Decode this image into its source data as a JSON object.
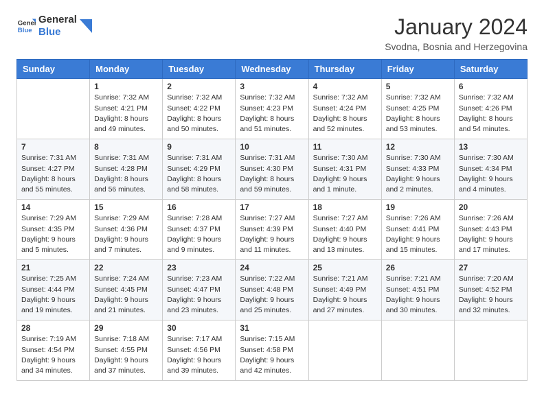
{
  "logo": {
    "text_general": "General",
    "text_blue": "Blue"
  },
  "header": {
    "month": "January 2024",
    "location": "Svodna, Bosnia and Herzegovina"
  },
  "weekdays": [
    "Sunday",
    "Monday",
    "Tuesday",
    "Wednesday",
    "Thursday",
    "Friday",
    "Saturday"
  ],
  "weeks": [
    [
      {
        "day": "",
        "sunrise": "",
        "sunset": "",
        "daylight": ""
      },
      {
        "day": "1",
        "sunrise": "Sunrise: 7:32 AM",
        "sunset": "Sunset: 4:21 PM",
        "daylight": "Daylight: 8 hours and 49 minutes."
      },
      {
        "day": "2",
        "sunrise": "Sunrise: 7:32 AM",
        "sunset": "Sunset: 4:22 PM",
        "daylight": "Daylight: 8 hours and 50 minutes."
      },
      {
        "day": "3",
        "sunrise": "Sunrise: 7:32 AM",
        "sunset": "Sunset: 4:23 PM",
        "daylight": "Daylight: 8 hours and 51 minutes."
      },
      {
        "day": "4",
        "sunrise": "Sunrise: 7:32 AM",
        "sunset": "Sunset: 4:24 PM",
        "daylight": "Daylight: 8 hours and 52 minutes."
      },
      {
        "day": "5",
        "sunrise": "Sunrise: 7:32 AM",
        "sunset": "Sunset: 4:25 PM",
        "daylight": "Daylight: 8 hours and 53 minutes."
      },
      {
        "day": "6",
        "sunrise": "Sunrise: 7:32 AM",
        "sunset": "Sunset: 4:26 PM",
        "daylight": "Daylight: 8 hours and 54 minutes."
      }
    ],
    [
      {
        "day": "7",
        "sunrise": "Sunrise: 7:31 AM",
        "sunset": "Sunset: 4:27 PM",
        "daylight": "Daylight: 8 hours and 55 minutes."
      },
      {
        "day": "8",
        "sunrise": "Sunrise: 7:31 AM",
        "sunset": "Sunset: 4:28 PM",
        "daylight": "Daylight: 8 hours and 56 minutes."
      },
      {
        "day": "9",
        "sunrise": "Sunrise: 7:31 AM",
        "sunset": "Sunset: 4:29 PM",
        "daylight": "Daylight: 8 hours and 58 minutes."
      },
      {
        "day": "10",
        "sunrise": "Sunrise: 7:31 AM",
        "sunset": "Sunset: 4:30 PM",
        "daylight": "Daylight: 8 hours and 59 minutes."
      },
      {
        "day": "11",
        "sunrise": "Sunrise: 7:30 AM",
        "sunset": "Sunset: 4:31 PM",
        "daylight": "Daylight: 9 hours and 1 minute."
      },
      {
        "day": "12",
        "sunrise": "Sunrise: 7:30 AM",
        "sunset": "Sunset: 4:33 PM",
        "daylight": "Daylight: 9 hours and 2 minutes."
      },
      {
        "day": "13",
        "sunrise": "Sunrise: 7:30 AM",
        "sunset": "Sunset: 4:34 PM",
        "daylight": "Daylight: 9 hours and 4 minutes."
      }
    ],
    [
      {
        "day": "14",
        "sunrise": "Sunrise: 7:29 AM",
        "sunset": "Sunset: 4:35 PM",
        "daylight": "Daylight: 9 hours and 5 minutes."
      },
      {
        "day": "15",
        "sunrise": "Sunrise: 7:29 AM",
        "sunset": "Sunset: 4:36 PM",
        "daylight": "Daylight: 9 hours and 7 minutes."
      },
      {
        "day": "16",
        "sunrise": "Sunrise: 7:28 AM",
        "sunset": "Sunset: 4:37 PM",
        "daylight": "Daylight: 9 hours and 9 minutes."
      },
      {
        "day": "17",
        "sunrise": "Sunrise: 7:27 AM",
        "sunset": "Sunset: 4:39 PM",
        "daylight": "Daylight: 9 hours and 11 minutes."
      },
      {
        "day": "18",
        "sunrise": "Sunrise: 7:27 AM",
        "sunset": "Sunset: 4:40 PM",
        "daylight": "Daylight: 9 hours and 13 minutes."
      },
      {
        "day": "19",
        "sunrise": "Sunrise: 7:26 AM",
        "sunset": "Sunset: 4:41 PM",
        "daylight": "Daylight: 9 hours and 15 minutes."
      },
      {
        "day": "20",
        "sunrise": "Sunrise: 7:26 AM",
        "sunset": "Sunset: 4:43 PM",
        "daylight": "Daylight: 9 hours and 17 minutes."
      }
    ],
    [
      {
        "day": "21",
        "sunrise": "Sunrise: 7:25 AM",
        "sunset": "Sunset: 4:44 PM",
        "daylight": "Daylight: 9 hours and 19 minutes."
      },
      {
        "day": "22",
        "sunrise": "Sunrise: 7:24 AM",
        "sunset": "Sunset: 4:45 PM",
        "daylight": "Daylight: 9 hours and 21 minutes."
      },
      {
        "day": "23",
        "sunrise": "Sunrise: 7:23 AM",
        "sunset": "Sunset: 4:47 PM",
        "daylight": "Daylight: 9 hours and 23 minutes."
      },
      {
        "day": "24",
        "sunrise": "Sunrise: 7:22 AM",
        "sunset": "Sunset: 4:48 PM",
        "daylight": "Daylight: 9 hours and 25 minutes."
      },
      {
        "day": "25",
        "sunrise": "Sunrise: 7:21 AM",
        "sunset": "Sunset: 4:49 PM",
        "daylight": "Daylight: 9 hours and 27 minutes."
      },
      {
        "day": "26",
        "sunrise": "Sunrise: 7:21 AM",
        "sunset": "Sunset: 4:51 PM",
        "daylight": "Daylight: 9 hours and 30 minutes."
      },
      {
        "day": "27",
        "sunrise": "Sunrise: 7:20 AM",
        "sunset": "Sunset: 4:52 PM",
        "daylight": "Daylight: 9 hours and 32 minutes."
      }
    ],
    [
      {
        "day": "28",
        "sunrise": "Sunrise: 7:19 AM",
        "sunset": "Sunset: 4:54 PM",
        "daylight": "Daylight: 9 hours and 34 minutes."
      },
      {
        "day": "29",
        "sunrise": "Sunrise: 7:18 AM",
        "sunset": "Sunset: 4:55 PM",
        "daylight": "Daylight: 9 hours and 37 minutes."
      },
      {
        "day": "30",
        "sunrise": "Sunrise: 7:17 AM",
        "sunset": "Sunset: 4:56 PM",
        "daylight": "Daylight: 9 hours and 39 minutes."
      },
      {
        "day": "31",
        "sunrise": "Sunrise: 7:15 AM",
        "sunset": "Sunset: 4:58 PM",
        "daylight": "Daylight: 9 hours and 42 minutes."
      },
      {
        "day": "",
        "sunrise": "",
        "sunset": "",
        "daylight": ""
      },
      {
        "day": "",
        "sunrise": "",
        "sunset": "",
        "daylight": ""
      },
      {
        "day": "",
        "sunrise": "",
        "sunset": "",
        "daylight": ""
      }
    ]
  ]
}
